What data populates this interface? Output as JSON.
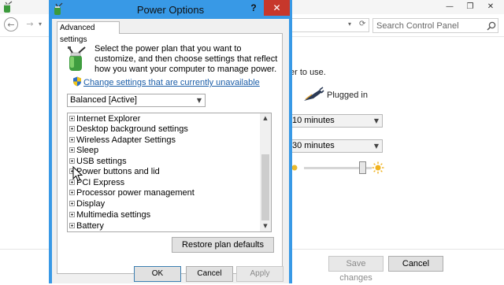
{
  "background_window": {
    "search": {
      "placeholder": "Search Control Panel"
    },
    "use_text": "er to use.",
    "plugged_in": "Plugged in",
    "combo1": "10 minutes",
    "combo2": "30 minutes",
    "buttons": {
      "save": "Save changes",
      "cancel": "Cancel"
    },
    "window_controls": {
      "minimize": "—",
      "maximize": "❐",
      "close": "✕"
    }
  },
  "dialog": {
    "title": "Power Options",
    "help": "?",
    "close": "✕",
    "tab": "Advanced settings",
    "description": "Select the power plan that you want to customize, and then choose settings that reflect how you want your computer to manage power.",
    "change_link": "Change settings that are currently unavailable",
    "plan": "Balanced [Active]",
    "tree_items": [
      "Internet Explorer",
      "Desktop background settings",
      "Wireless Adapter Settings",
      "Sleep",
      "USB settings",
      "Power buttons and lid",
      "PCI Express",
      "Processor power management",
      "Display",
      "Multimedia settings",
      "Battery"
    ],
    "restore_button": "Restore plan defaults",
    "ok": "OK",
    "cancel": "Cancel",
    "apply": "Apply"
  },
  "colors": {
    "dialog_frame": "#3899e6",
    "close_button": "#c7372b",
    "link": "#1c5ea8"
  }
}
